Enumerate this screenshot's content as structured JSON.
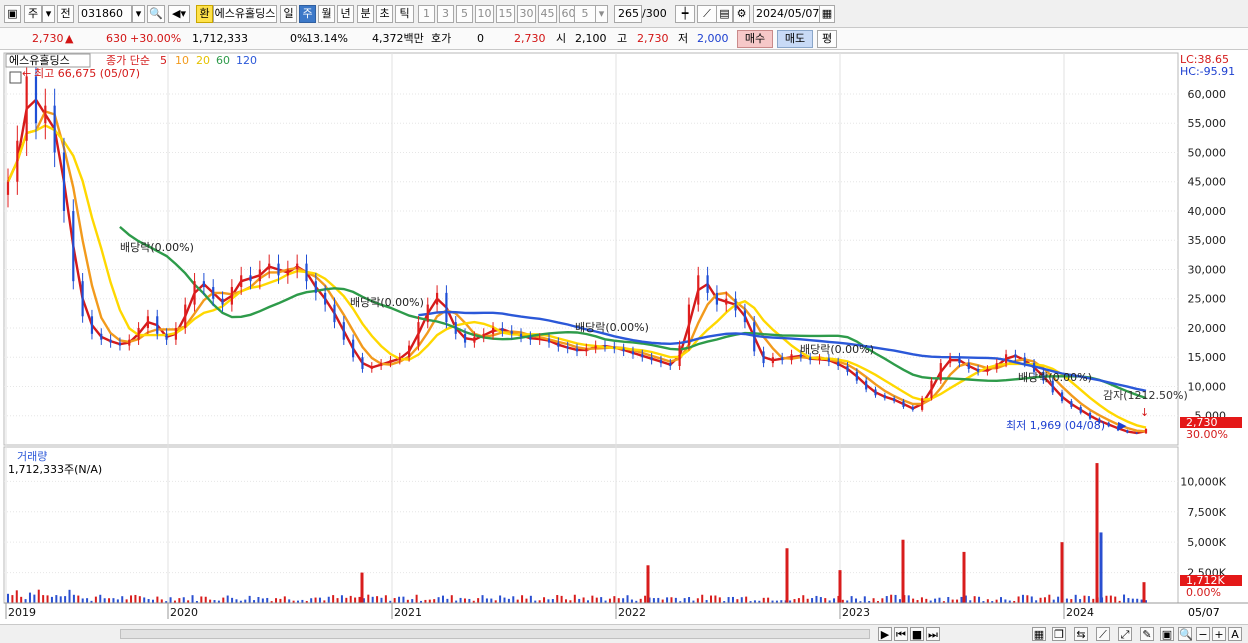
{
  "toolbar": {
    "market": "주",
    "prefix": "전",
    "code": "031860",
    "currency_badge": "환",
    "stock_name": "에스유홀딩스",
    "periods": [
      "일",
      "주",
      "월",
      "년",
      "분",
      "초",
      "틱"
    ],
    "selected_period": "주",
    "intervals": [
      "1",
      "3",
      "5",
      "10",
      "15",
      "30",
      "45",
      "60"
    ],
    "interval_select": "5",
    "count": "265",
    "count_total": "/300",
    "date": "2024/05/07"
  },
  "quote": {
    "price": "2,730",
    "change": "630",
    "change_pct": "+30.00%",
    "volume": "1,712,333",
    "ratio1": "0%",
    "ratio2": "13.14%",
    "amount": "4,372백만",
    "hoga_label": "호가",
    "hoga_value": "0",
    "hoga_price": "2,730",
    "open_label": "시",
    "open": "2,100",
    "high_label": "고",
    "high": "2,730",
    "low_label": "저",
    "low": "2,000",
    "buy_label": "매수",
    "sell_label": "매도",
    "avg_label": "평"
  },
  "price_panel": {
    "name_tag": "에스유홀딩스",
    "legend_title": "종가 단순",
    "ma_periods": [
      "5",
      "10",
      "20",
      "60",
      "120"
    ],
    "ma_colors": [
      "#d41b1b",
      "#f29a1c",
      "#ffd800",
      "#2e9b4a",
      "#2b58d8"
    ],
    "high_note": "최고 66,675 (05/07)",
    "low_note": "최저 1,969 (04/08)",
    "lc": "LC:38.65",
    "hc": "HC:-95.91",
    "cap_note": "감자(1212.50%)",
    "last_price_label": "2,730",
    "last_pct_label": "30.00%",
    "dividend_label": "배당락(0.00%)"
  },
  "volume_panel": {
    "title": "거래량",
    "subtitle": "1,712,333주(N/A)",
    "last_label": "1,712K",
    "last_pct": "0.00%"
  },
  "date_axis": {
    "last": "05/07"
  },
  "chart_data": [
    {
      "type": "candlestick",
      "x": [
        "2019",
        "2020",
        "2021",
        "2022",
        "2023",
        "2024"
      ],
      "ylim": [
        0,
        67000
      ],
      "y_ticks": [
        5000,
        10000,
        15000,
        20000,
        25000,
        30000,
        35000,
        40000,
        45000,
        50000,
        55000,
        60000
      ],
      "price_series": [
        45000,
        52000,
        63000,
        55000,
        58000,
        50000,
        40000,
        28000,
        22000,
        19000,
        18000,
        17500,
        17000,
        18000,
        20000,
        22000,
        19000,
        18000,
        20000,
        24000,
        28000,
        27000,
        25000,
        24000,
        27000,
        29000,
        28000,
        30000,
        31000,
        29000,
        30000,
        31000,
        28000,
        26000,
        24000,
        21000,
        18000,
        15000,
        13000,
        13500,
        14000,
        14500,
        15000,
        17000,
        21000,
        24000,
        26000,
        21000,
        19000,
        17500,
        18500,
        19000,
        20000,
        19500,
        19000,
        18500,
        18000,
        18200,
        17500,
        16800,
        16500,
        16000,
        16500,
        17000,
        16800,
        16500,
        16000,
        15500,
        15000,
        14500,
        14000,
        13500,
        17000,
        24000,
        29000,
        26000,
        24000,
        25000,
        23000,
        21000,
        16000,
        14000,
        15000,
        14500,
        15500,
        15000,
        14500,
        14800,
        14200,
        13500,
        12500,
        11000,
        9500,
        8500,
        8000,
        7500,
        6500,
        6000,
        8000,
        11000,
        14000,
        15000,
        14000,
        13000,
        12500,
        13000,
        14000,
        15500,
        15000,
        14000,
        12500,
        11000,
        9000,
        7500,
        6500,
        5500,
        4500,
        3800,
        3200,
        2500,
        2100,
        2000,
        2730
      ],
      "dividend_markers": [
        "2019",
        "2020",
        "2021",
        "2022",
        "2022",
        "2023"
      ],
      "series": [
        {
          "name": "5",
          "color": "#d41b1b"
        },
        {
          "name": "10",
          "color": "#f29a1c"
        },
        {
          "name": "20",
          "color": "#ffd800"
        },
        {
          "name": "60",
          "color": "#2e9b4a"
        },
        {
          "name": "120",
          "color": "#2b58d8"
        }
      ],
      "annotations": [
        "최고 66,675 (05/07)",
        "최저 1,969 (04/08)",
        "감자(1212.50%)"
      ]
    },
    {
      "type": "bar",
      "title": "거래량",
      "ylim": [
        0,
        12000
      ],
      "y_ticks_label": [
        "2,500K",
        "5,000K",
        "7,500K",
        "10,000K"
      ],
      "y_ticks": [
        2500,
        5000,
        7500,
        10000
      ],
      "spikes": [
        {
          "x": "2020-11",
          "value": 2500
        },
        {
          "x": "2022-01",
          "value": 3100
        },
        {
          "x": "2022-08",
          "value": 4500
        },
        {
          "x": "2022-12",
          "value": 2700
        },
        {
          "x": "2023-03",
          "value": 5200
        },
        {
          "x": "2023-07",
          "value": 4200
        },
        {
          "x": "2023-11",
          "value": 5000
        },
        {
          "x": "2024-01",
          "value": 11500
        },
        {
          "x": "2024-02",
          "value": 5800
        },
        {
          "x": "2024-05",
          "value": 1712
        }
      ]
    }
  ]
}
